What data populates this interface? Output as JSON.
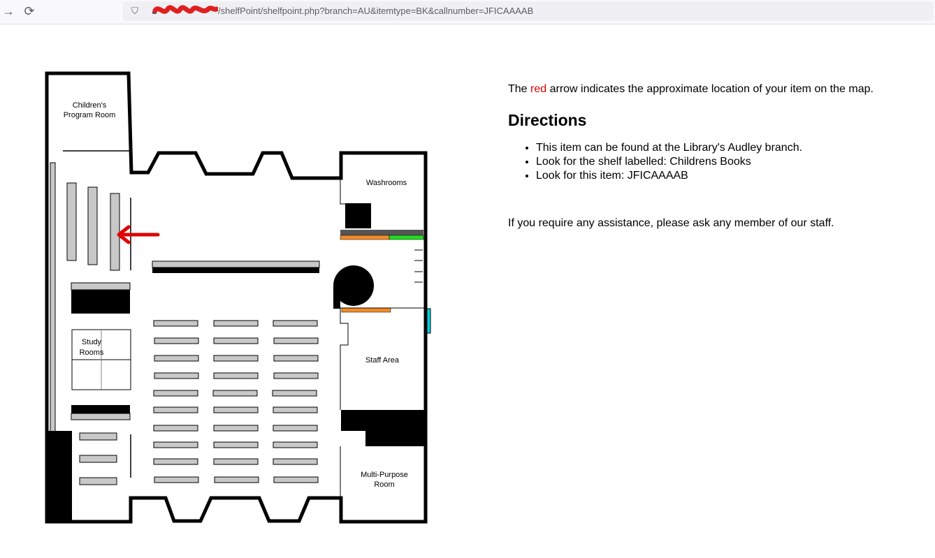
{
  "browser": {
    "back_icon": "arrow-right-icon",
    "reload_icon": "reload-icon",
    "url_visible": "/shelfPoint/shelfpoint.php?branch=AU&itemtype=BK&callnumber=JFICAAAAB"
  },
  "map": {
    "rooms": {
      "childrens_program_line1": "Children's",
      "childrens_program_line2": "Program Room",
      "washrooms": "Washrooms",
      "study_line1": "Study",
      "study_line2": "Rooms",
      "staff_area": "Staff Area",
      "multi_line1": "Multi-Purpose",
      "multi_line2": "Room"
    },
    "arrow_color": "#e00000"
  },
  "info": {
    "legend_prefix": "The ",
    "legend_red": "red",
    "legend_suffix": " arrow indicates the approximate location of your item on the map.",
    "heading": "Directions",
    "directions": [
      "This item can be found at the Library's Audley branch.",
      "Look for the shelf labelled: Childrens Books",
      "Look for this item: JFICAAAAB"
    ],
    "assistance": "If you require any assistance, please ask any member of our staff."
  }
}
